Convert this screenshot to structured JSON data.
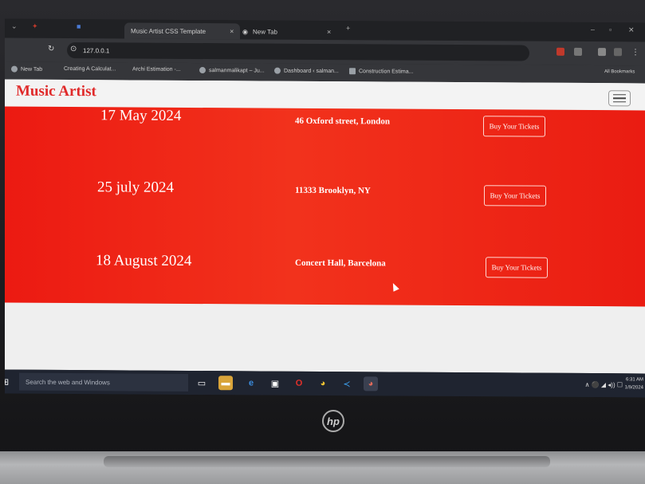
{
  "browser": {
    "tabs": [
      {
        "title": "Music Artist CSS Template",
        "active": true
      },
      {
        "title": "New Tab",
        "active": false
      }
    ],
    "new_tab_symbol": "+",
    "close_symbol": "×",
    "address": "127.0.0.1",
    "bookmarks": [
      "New Tab",
      "Creating A Calculat...",
      "Archi Estimation -...",
      "salmanmalikapt – Ju...",
      "Dashboard ‹ salman...",
      "Construction Estima..."
    ],
    "all_bookmarks": "All Bookmarks"
  },
  "site": {
    "brand": "Music Artist",
    "accent_color": "#e02a2a",
    "band_color": "#f0261a",
    "tour": [
      {
        "date": "17 May 2024",
        "venue": "46 Oxford street, London",
        "button": "Buy Your Tickets"
      },
      {
        "date": "25 july 2024",
        "venue": "11333 Brooklyn, NY",
        "button": "Buy Your Tickets"
      },
      {
        "date": "18 August 2024",
        "venue": "Concert Hall, Barcelona",
        "button": "Buy Your Tickets"
      }
    ]
  },
  "taskbar": {
    "search_placeholder": "Search the web and Windows",
    "time": "6:31 AM",
    "date": "1/9/2024",
    "icons": [
      "task-view-icon",
      "file-explorer-icon",
      "edge-icon",
      "store-icon",
      "opera-icon",
      "chrome-icon",
      "vscode-icon",
      "chrome-profile-icon"
    ]
  },
  "device": {
    "logo": "hp"
  }
}
